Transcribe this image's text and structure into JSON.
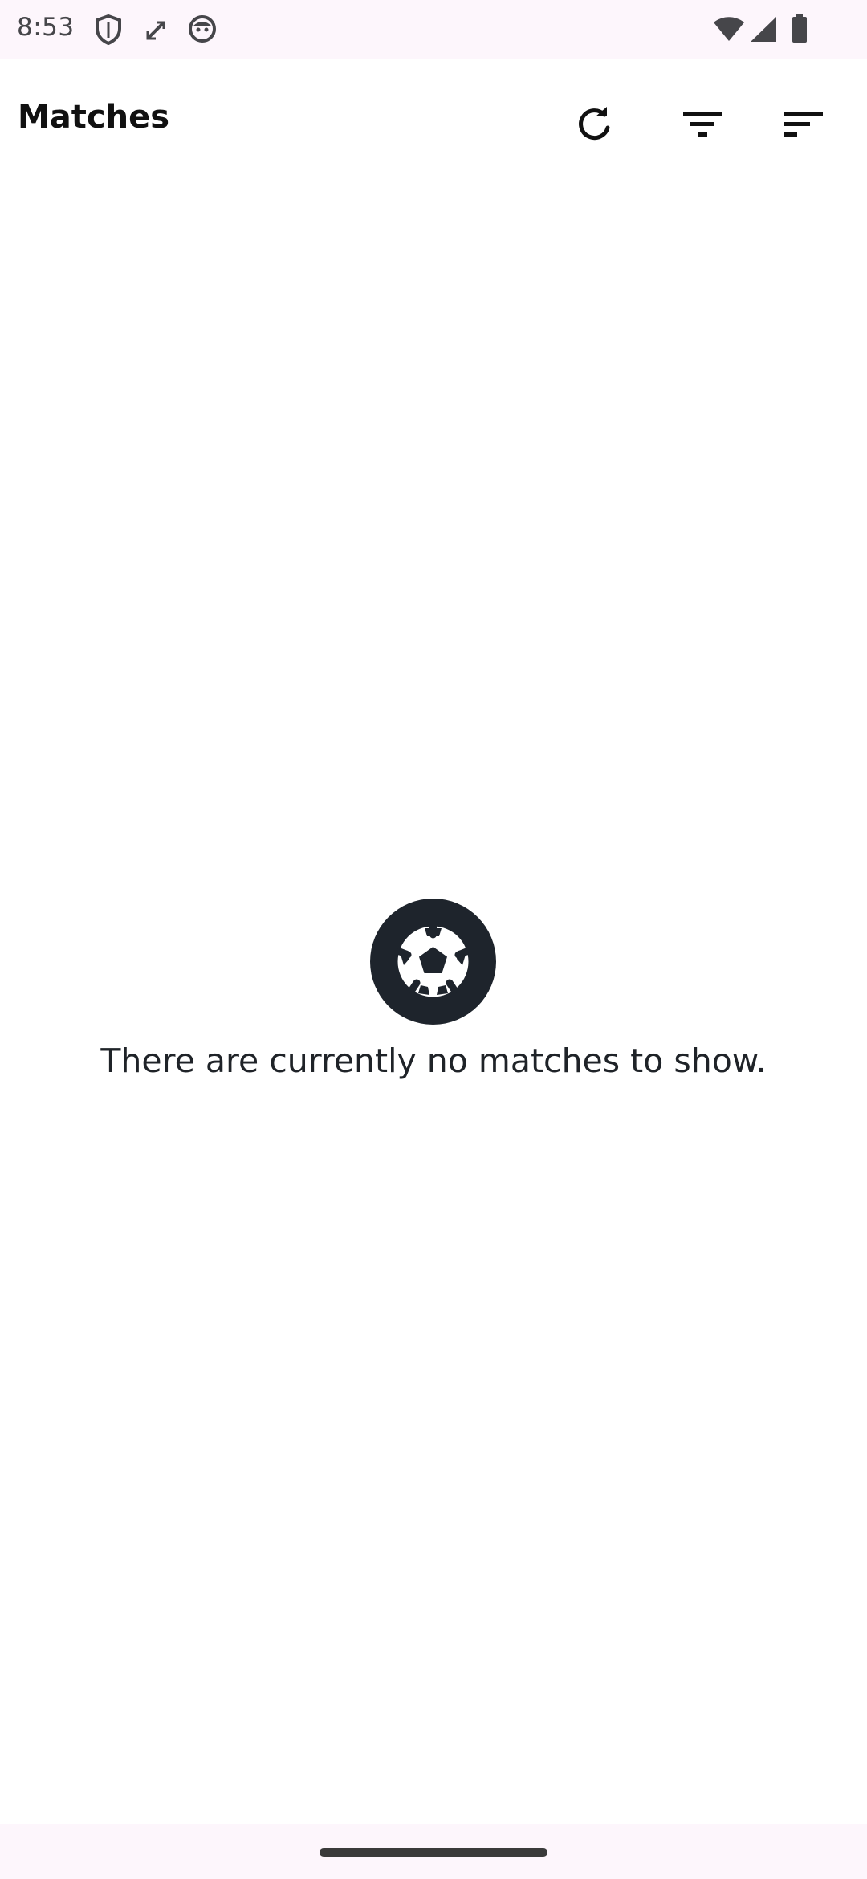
{
  "status_bar": {
    "time": "8:53",
    "icons": [
      "shield-icon",
      "screen-rotate-icon",
      "face-icon",
      "wifi-icon",
      "cellular-signal-icon",
      "battery-icon"
    ]
  },
  "app_bar": {
    "title": "Matches",
    "actions": [
      "refresh-icon",
      "filter-icon",
      "sort-icon"
    ]
  },
  "empty_state": {
    "icon": "soccer-ball-icon",
    "message": "There are currently no matches to show."
  },
  "colors": {
    "background": "#ffffff",
    "status_bar": "#fdf6fc",
    "icon_dark": "#1e242c",
    "text_dark": "#111111"
  }
}
